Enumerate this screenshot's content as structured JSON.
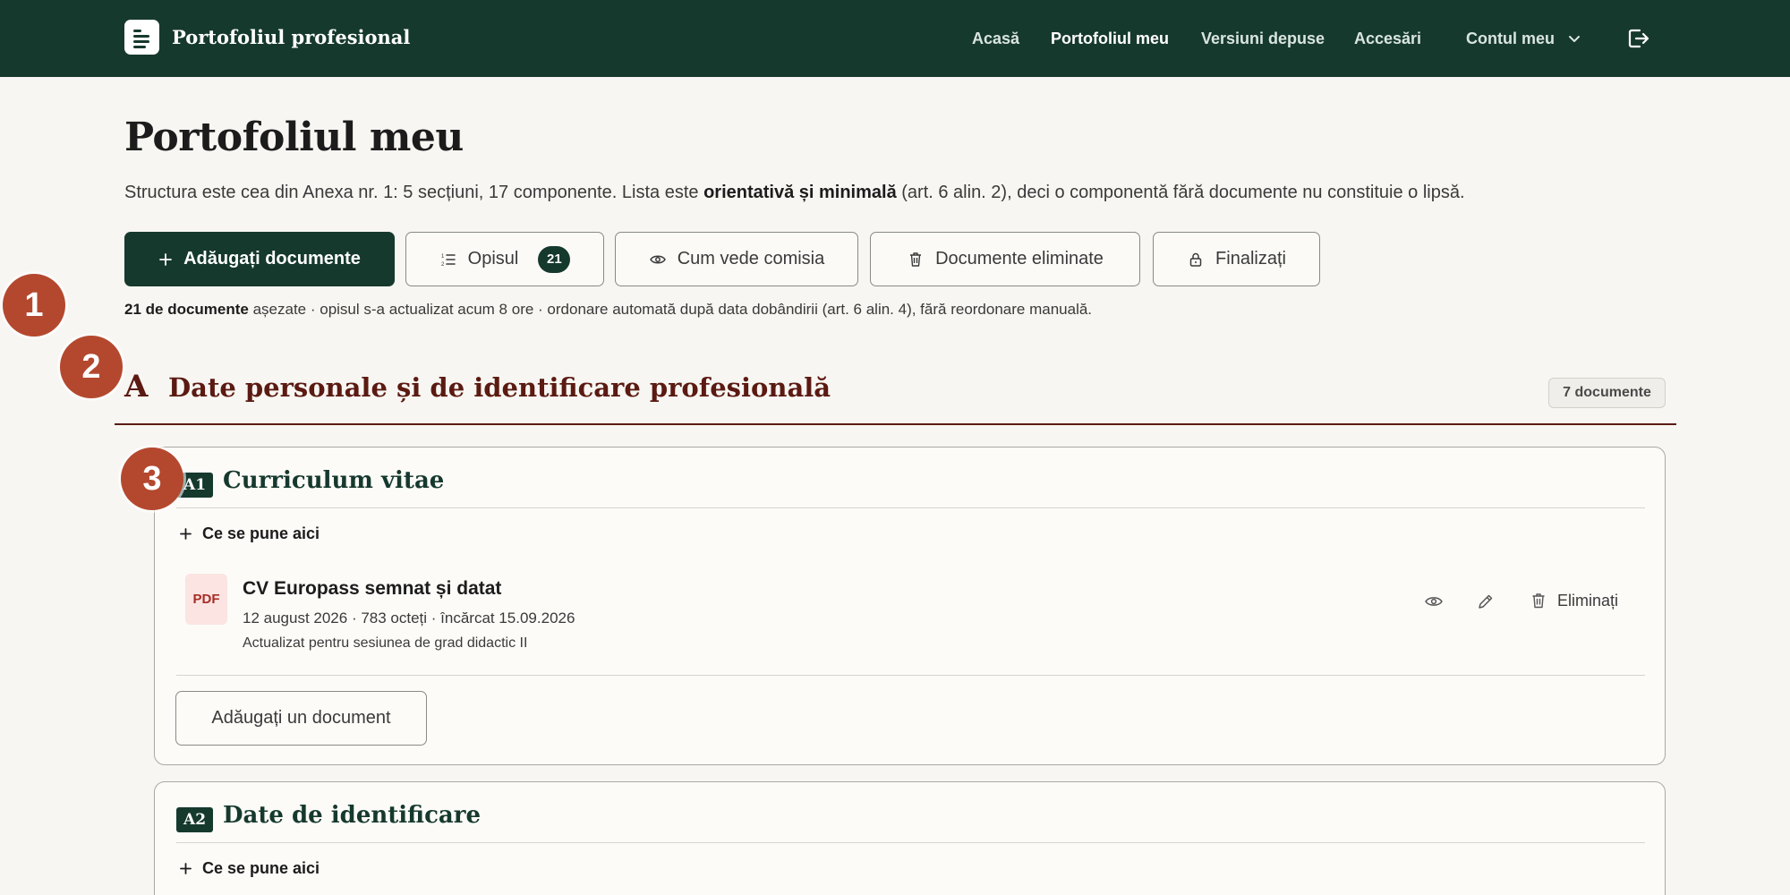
{
  "brand": {
    "title": "Portofoliul profesional",
    "logo_icon": "document-lines-icon"
  },
  "nav": {
    "items": [
      {
        "label": "Acasă",
        "active": false
      },
      {
        "label": "Portofoliul meu",
        "active": true
      },
      {
        "label": "Versiuni depuse",
        "active": false
      },
      {
        "label": "Accesări",
        "active": false
      }
    ],
    "account_label": "Contul meu",
    "account_icon": "chevron-down-icon",
    "logout_icon": "logout-icon"
  },
  "page": {
    "title": "Portofoliul meu",
    "intro_start": "Structura este cea din Anexa nr. 1: 5 secțiuni, 17 componente. Lista este ",
    "intro_bold": "orientativă și minimală",
    "intro_end": " (art. 6 alin. 2), deci o componentă fără documente nu constituie o lipsă."
  },
  "toolbar": {
    "add_label": "Adăugați documente",
    "opisul_label": "Opisul",
    "opisul_count": "21",
    "comisia_label": "Cum vede comisia",
    "eliminate_label": "Documente eliminate",
    "finalize_label": "Finalizați"
  },
  "status": {
    "count_bold": "21 de documente",
    "rest": " așezate · opisul s-a actualizat acum 8 ore · ordonare automată după data dobândirii (art. 6 alin. 4), fără reordonare manuală."
  },
  "markers": [
    "1",
    "2",
    "3"
  ],
  "section": {
    "letter": "A",
    "title": "Date personale și de identificare profesională",
    "count": "7 documente"
  },
  "components": [
    {
      "code": "A1",
      "title": "Curriculum vitae",
      "what_goes_here": "Ce se pune aici",
      "documents": [
        {
          "type_label": "PDF",
          "name": "CV Europass semnat și datat",
          "meta": "12 august 2026 · 783 octeți · încărcat 15.09.2026",
          "note": "Actualizat pentru sesiunea de grad didactic II",
          "delete_label": "Eliminați"
        }
      ],
      "add_label": "Adăugați un document"
    },
    {
      "code": "A2",
      "title": "Date de identificare",
      "what_goes_here": "Ce se pune aici"
    }
  ],
  "colors": {
    "primary": "#16392e",
    "section_accent": "#5b1a12",
    "marker": "#b4482e",
    "pdf": "#a82c25"
  }
}
